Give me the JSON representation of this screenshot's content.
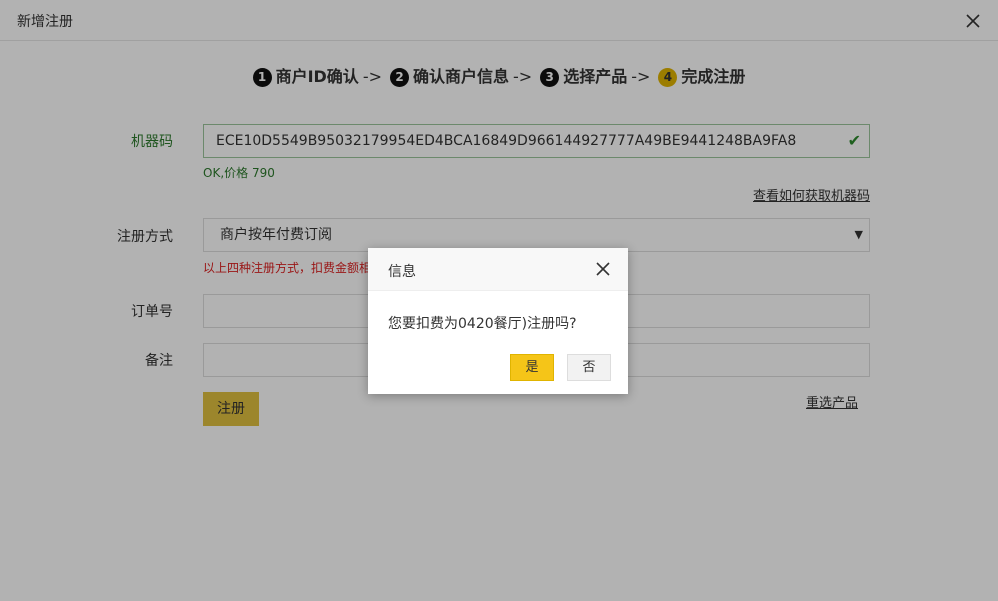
{
  "window": {
    "title": "新增注册"
  },
  "steps": [
    {
      "num": "1",
      "label": "商户ID确认"
    },
    {
      "num": "2",
      "label": "确认商户信息"
    },
    {
      "num": "3",
      "label": "选择产品"
    },
    {
      "num": "4",
      "label": "完成注册"
    }
  ],
  "step_separator": "->",
  "form": {
    "machine_code_label": "机器码",
    "machine_code_value": "ECE10D5549B95032179954ED4BCA16849D966144927777A49BE9441248BA9FA8",
    "machine_code_status": "OK,价格 790",
    "how_to_get_link": "查看如何获取机器码",
    "register_method_label": "注册方式",
    "register_method_value": "商户按年付费订阅",
    "register_method_warning": "以上四种注册方式，扣费金额相",
    "order_no_label": "订单号",
    "order_no_value": "",
    "remark_label": "备注",
    "remark_value": "",
    "submit_label": "注册",
    "reselect_link": "重选产品"
  },
  "dialog": {
    "title": "信息",
    "message": "您要扣费为0420餐厅)注册吗?",
    "yes_label": "是",
    "no_label": "否"
  },
  "colors": {
    "accent_yellow": "#f5c518",
    "ok_green": "#2d7a2d",
    "warning_red": "#dd2222"
  }
}
